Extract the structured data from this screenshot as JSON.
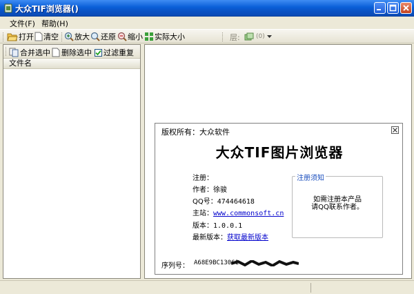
{
  "window": {
    "title": "大众TIF浏览器()"
  },
  "menu": {
    "items": [
      "文件(F)",
      "帮助(H)"
    ]
  },
  "toolbar": {
    "open": "打开",
    "clear": "清空",
    "zoom_in": "放大",
    "restore": "还原",
    "zoom_out": "缩小",
    "actual_size": "实际大小",
    "layer_label": "层:",
    "layer_value": "(0)"
  },
  "left_panel": {
    "merge_selected": "合并选中",
    "delete_selected": "删除选中",
    "filter_duplicates": "过滤重复",
    "filter_checked": true,
    "column_header": "文件名"
  },
  "about": {
    "copyright": "版权所有：大众软件",
    "app_title": "大众TIF图片浏览器",
    "register_label": "注册：",
    "author_label": "作者：",
    "author_value": "徐骏",
    "qq_label": "QQ号：",
    "qq_value": "474464618",
    "site_label": "主站：",
    "site_value": "www.commonsoft.cn",
    "version_label": "版本：",
    "version_value": "1.0.0.1",
    "latest_label": "最新版本：",
    "latest_link": "获取最新版本",
    "notice_title": "注册须知",
    "notice_line1": "如需注册本产品",
    "notice_line2": "请QQ联系作者。",
    "serial_label": "序列号：",
    "serial_value": "A68E9BC13061"
  },
  "colors": {
    "titlebar": "#0a5fd8",
    "link": "#0000cc",
    "notice_title": "#1c4fbe"
  }
}
